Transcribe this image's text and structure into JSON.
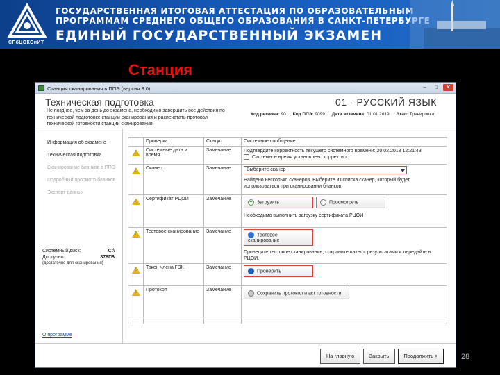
{
  "banner": {
    "line1": "ГОСУДАРСТВЕННАЯ ИТОГОВАЯ АТТЕСТАЦИЯ ПО ОБРАЗОВАТЕЛЬНЫМ",
    "line2": "ПРОГРАММАМ СРЕДНЕГО ОБЩЕГО ОБРАЗОВАНИЯ В САНКТ-ПЕТЕРБУРГЕ",
    "line3": "ЕДИНЫЙ ГОСУДАРСТВЕННЫЙ ЭКЗАМЕН",
    "logo_text": "СПбЦОКОиИТ"
  },
  "slide_title": "Станция",
  "window": {
    "title": "Станция сканирования в ППЭ (версия 3.0)",
    "heading": "Техническая подготовка",
    "description": "Не позднее, чем за день до экзамена, необходимо завершить все действия по технической подготовке станции сканирования и распечатать протокол технической готовности станции сканирования.",
    "exam_title": "01 - РУССКИЙ ЯЗЫК",
    "meta": {
      "region_label": "Код региона:",
      "region_value": "90",
      "ppe_label": "Код ППЭ:",
      "ppe_value": "9099",
      "date_label": "Дата экзамена:",
      "date_value": "01.01.2019",
      "stage_label": "Этап:",
      "stage_value": "Тренировка"
    }
  },
  "sidebar": {
    "items": [
      {
        "label": "Информация об экзамене",
        "enabled": true
      },
      {
        "label": "Техническая подготовка",
        "enabled": true
      },
      {
        "label": "Сканирование бланков в ППЭ",
        "enabled": false
      },
      {
        "label": "Подробный просмотр бланков",
        "enabled": false
      },
      {
        "label": "Экспорт данных",
        "enabled": false
      }
    ],
    "disk_label": "Системный диск:",
    "disk_value": "C:\\",
    "avail_label": "Доступно:",
    "avail_value": "878ГБ",
    "avail_note": "(достаточно для сканирования)",
    "about": "О программе"
  },
  "table": {
    "headers": [
      "Проверка",
      "Статус",
      "Системное сообщение"
    ],
    "rows": [
      {
        "check": "Системные дата и время",
        "status": "Замечание",
        "message": "Подтвердите корректность текущего системного времени: 20.02.2018 12:21:43",
        "checkbox_label": "Системное время установлено корректно"
      },
      {
        "check": "Сканер",
        "status": "Замечание",
        "select_value": "Выберите сканер",
        "message": "Найдено несколько сканеров. Выберите из списка сканер, который будет использоваться при сканировании бланков"
      },
      {
        "check": "Сертификат РЦОИ",
        "status": "Замечание",
        "btn1": "Загрузить",
        "btn2": "Просмотреть",
        "message": "Необходимо выполнить загрузку сертификата РЦОИ"
      },
      {
        "check": "Тестовое сканирование",
        "status": "Замечание",
        "btn1": "Тестовое сканирование",
        "message": "Проведите тестовое сканирование, сохраните пакет с результатами и передайте в РЦОИ."
      },
      {
        "check": "Токен члена ГЭК",
        "status": "Замечание",
        "btn1": "Проверить"
      },
      {
        "check": "Протокол",
        "status": "Замечание",
        "btn1": "Сохранить протокол и акт готовности"
      }
    ]
  },
  "footer": {
    "home": "На главную",
    "close": "Закрыть",
    "next": "Продолжить >"
  },
  "page_number": "28",
  "colors": {
    "banner": "#1559b8",
    "title_red": "#e81010",
    "warning": "#e3b21a",
    "highlight_red": "#e33b3b"
  }
}
